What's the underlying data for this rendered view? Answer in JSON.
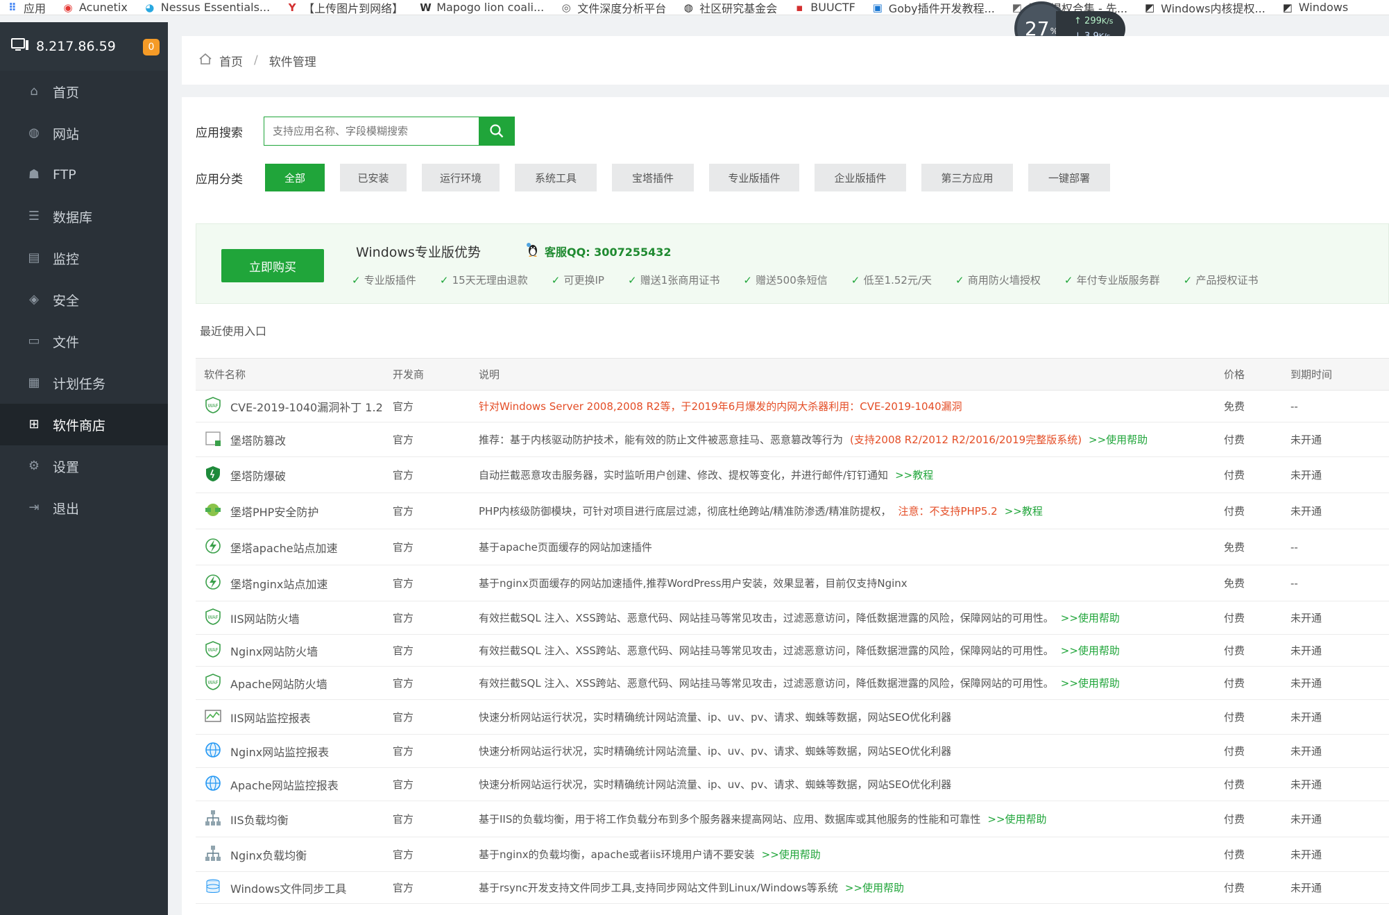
{
  "bookmarks": [
    {
      "label": "应用",
      "icon": "apps-grid-icon",
      "color": "#4285f4"
    },
    {
      "label": "Acunetix",
      "icon": "acunetix-icon",
      "color": "#e53935"
    },
    {
      "label": "Nessus Essentials...",
      "icon": "nessus-icon",
      "color": "#29a8e0"
    },
    {
      "label": "【上传图片到网络】",
      "icon": "y-icon",
      "color": "#d32f2f"
    },
    {
      "label": "Mapogo lion coali...",
      "icon": "wikipedia-icon",
      "color": "#333333"
    },
    {
      "label": "文件深度分析平台",
      "icon": "eye-icon",
      "color": "#555555"
    },
    {
      "label": "社区研究基金会",
      "icon": "globe-icon",
      "color": "#222222"
    },
    {
      "label": "BUUCTF",
      "icon": "buuctf-icon",
      "color": "#d32f2f"
    },
    {
      "label": "Goby插件开发教程...",
      "icon": "goby-icon",
      "color": "#1976d2"
    },
    {
      "label": "域控提权合集 - 先...",
      "icon": "doc-icon",
      "color": "#666666"
    },
    {
      "label": "Windows内核提权...",
      "icon": "doc-icon",
      "color": "#333333"
    },
    {
      "label": "Windows",
      "icon": "doc-icon",
      "color": "#333333"
    }
  ],
  "speed": {
    "percent": "27",
    "unit": "%",
    "up": "299",
    "up_unit": "K/s",
    "down": "3.9",
    "down_unit": "K/s"
  },
  "sidebar": {
    "host": "8.217.86.59",
    "badge": "0",
    "items": [
      {
        "label": "首页",
        "icon": "home-icon"
      },
      {
        "label": "网站",
        "icon": "globe-icon"
      },
      {
        "label": "FTP",
        "icon": "ftp-icon"
      },
      {
        "label": "数据库",
        "icon": "database-icon"
      },
      {
        "label": "监控",
        "icon": "monitor-icon"
      },
      {
        "label": "安全",
        "icon": "shield-icon"
      },
      {
        "label": "文件",
        "icon": "folder-icon"
      },
      {
        "label": "计划任务",
        "icon": "calendar-icon"
      },
      {
        "label": "软件商店",
        "icon": "app-store-icon"
      },
      {
        "label": "设置",
        "icon": "gear-icon"
      },
      {
        "label": "退出",
        "icon": "logout-icon"
      }
    ]
  },
  "breadcrumb": {
    "home": "首页",
    "sep": "/",
    "current": "软件管理"
  },
  "search": {
    "label": "应用搜索",
    "placeholder": "支持应用名称、字段模糊搜索"
  },
  "categories": {
    "label": "应用分类",
    "items": [
      "全部",
      "已安装",
      "运行环境",
      "系统工具",
      "宝塔插件",
      "专业版插件",
      "企业版插件",
      "第三方应用",
      "一键部署"
    ]
  },
  "promo": {
    "buy_label": "立即购买",
    "title": "Windows专业版优势",
    "qq": "客服QQ: 3007255432",
    "features": [
      "专业版插件",
      "15天无理由退款",
      "可更换IP",
      "赠送1张商用证书",
      "赠送500条短信",
      "低至1.52元/天",
      "商用防火墙授权",
      "年付专业版服务群",
      "产品授权证书"
    ]
  },
  "recent_label": "最近使用入口",
  "table": {
    "headers": {
      "name": "软件名称",
      "vendor": "开发商",
      "desc": "说明",
      "price": "价格",
      "expire": "到期时间"
    },
    "rows": [
      {
        "name": "CVE-2019-1040漏洞补丁 1.2",
        "vendor": "官方",
        "desc": "针对Windows Server 2008,2008 R2等，于2019年6月爆发的内网大杀器利用：CVE-2019-1040漏洞",
        "desc_extra": "",
        "desc_link": "",
        "price": "免费",
        "expire": "--",
        "icon": "waf-shield-icon",
        "desc_red": true
      },
      {
        "name": "堡塔防篡改",
        "vendor": "官方",
        "desc": "推荐：基于内核驱动防护技术，能有效的防止文件被恶意挂马、恶意篡改等行为",
        "desc_extra": "(支持2008 R2/2012 R2/2016/2019完整版系统)",
        "desc_link": ">>使用帮助",
        "price": "付费",
        "expire": "未开通",
        "icon": "tamper-proof-icon",
        "desc_red": false
      },
      {
        "name": "堡塔防爆破",
        "vendor": "官方",
        "desc": "自动拦截恶意攻击服务器，实时监听用户创建、修改、提权等变化，并进行邮件/钉钉通知",
        "desc_extra": "",
        "desc_link": ">>教程",
        "price": "付费",
        "expire": "未开通",
        "icon": "shield-icon",
        "desc_red": false
      },
      {
        "name": "堡塔PHP安全防护",
        "vendor": "官方",
        "desc": "PHP内核级防御模块，可针对项目进行底层过滤，彻底杜绝跨站/精准防渗透/精准防提权，",
        "desc_extra": "注意：不支持PHP5.2",
        "desc_link": ">>教程",
        "price": "付费",
        "expire": "未开通",
        "icon": "php-shield-icon",
        "desc_red": false
      },
      {
        "name": "堡塔apache站点加速",
        "vendor": "官方",
        "desc": "基于apache页面缓存的网站加速插件",
        "desc_extra": "",
        "desc_link": "",
        "price": "免费",
        "expire": "--",
        "icon": "lightning-icon",
        "desc_red": false
      },
      {
        "name": "堡塔nginx站点加速",
        "vendor": "官方",
        "desc": "基于nginx页面缓存的网站加速插件,推荐WordPress用户安装，效果显著，目前仅支持Nginx",
        "desc_extra": "",
        "desc_link": "",
        "price": "免费",
        "expire": "--",
        "icon": "lightning-icon",
        "desc_red": false
      },
      {
        "name": "IIS网站防火墙",
        "vendor": "官方",
        "desc": "有效拦截SQL 注入、XSS跨站、恶意代码、网站挂马等常见攻击，过滤恶意访问，降低数据泄露的风险，保障网站的可用性。",
        "desc_extra": "",
        "desc_link": ">>使用帮助",
        "price": "付费",
        "expire": "未开通",
        "icon": "waf-shield-icon",
        "desc_red": false
      },
      {
        "name": "Nginx网站防火墙",
        "vendor": "官方",
        "desc": "有效拦截SQL 注入、XSS跨站、恶意代码、网站挂马等常见攻击，过滤恶意访问，降低数据泄露的风险，保障网站的可用性。",
        "desc_extra": "",
        "desc_link": ">>使用帮助",
        "price": "付费",
        "expire": "未开通",
        "icon": "waf-shield-icon",
        "desc_red": false
      },
      {
        "name": "Apache网站防火墙",
        "vendor": "官方",
        "desc": "有效拦截SQL 注入、XSS跨站、恶意代码、网站挂马等常见攻击，过滤恶意访问，降低数据泄露的风险，保障网站的可用性。",
        "desc_extra": "",
        "desc_link": ">>使用帮助",
        "price": "付费",
        "expire": "未开通",
        "icon": "waf-shield-icon",
        "desc_red": false
      },
      {
        "name": "IIS网站监控报表",
        "vendor": "官方",
        "desc": "快速分析网站运行状况，实时精确统计网站流量、ip、uv、pv、请求、蜘蛛等数据，网站SEO优化利器",
        "desc_extra": "",
        "desc_link": "",
        "price": "付费",
        "expire": "未开通",
        "icon": "chart-report-icon",
        "desc_red": false
      },
      {
        "name": "Nginx网站监控报表",
        "vendor": "官方",
        "desc": "快速分析网站运行状况，实时精确统计网站流量、ip、uv、pv、请求、蜘蛛等数据，网站SEO优化利器",
        "desc_extra": "",
        "desc_link": "",
        "price": "付费",
        "expire": "未开通",
        "icon": "globe-report-icon",
        "desc_red": false
      },
      {
        "name": "Apache网站监控报表",
        "vendor": "官方",
        "desc": "快速分析网站运行状况，实时精确统计网站流量、ip、uv、pv、请求、蜘蛛等数据，网站SEO优化利器",
        "desc_extra": "",
        "desc_link": "",
        "price": "付费",
        "expire": "未开通",
        "icon": "globe-report-icon",
        "desc_red": false
      },
      {
        "name": "IIS负载均衡",
        "vendor": "官方",
        "desc": "基于IIS的负载均衡，用于将工作负载分布到多个服务器来提高网站、应用、数据库或其他服务的性能和可靠性",
        "desc_extra": "",
        "desc_link": ">>使用帮助",
        "price": "付费",
        "expire": "未开通",
        "icon": "load-balance-icon",
        "desc_red": false
      },
      {
        "name": "Nginx负载均衡",
        "vendor": "官方",
        "desc": "基于nginx的负载均衡，apache或者iis环境用户请不要安装",
        "desc_extra": "",
        "desc_link": ">>使用帮助",
        "price": "付费",
        "expire": "未开通",
        "icon": "load-balance-icon",
        "desc_red": false
      },
      {
        "name": "Windows文件同步工具",
        "vendor": "官方",
        "desc": "基于rsync开发支持文件同步工具,支持同步网站文件到Linux/Windows等系统",
        "desc_extra": "",
        "desc_link": ">>使用帮助",
        "price": "付费",
        "expire": "未开通",
        "icon": "file-sync-icon",
        "desc_red": false
      }
    ]
  },
  "colors": {
    "accent": "#20a53a",
    "paid": "#f59b27",
    "warn": "#e44d26",
    "sidebar": "#2a3138"
  }
}
